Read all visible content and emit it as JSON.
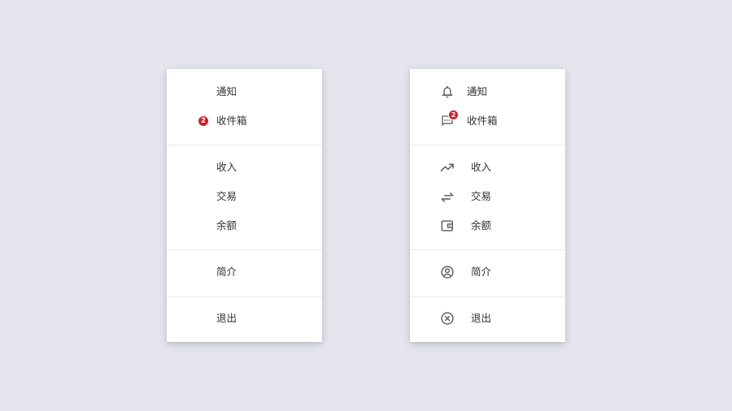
{
  "colors": {
    "background": "#e4e5ed",
    "menu": "#ffffff",
    "badge": "#d0202b",
    "icon": "#5f6368",
    "text": "#333333"
  },
  "menu_left": {
    "notifications_label": "通知",
    "inbox_label": "收件箱",
    "inbox_badge": "2",
    "income_label": "收入",
    "transactions_label": "交易",
    "balance_label": "余额",
    "profile_label": "简介",
    "logout_label": "退出"
  },
  "menu_right": {
    "notifications_label": "通知",
    "notifications_icon": "bell-icon",
    "inbox_label": "收件箱",
    "inbox_icon": "message-icon",
    "inbox_badge": "2",
    "income_label": "收入",
    "income_icon": "trending-up-icon",
    "transactions_label": "交易",
    "transactions_icon": "swap-arrows-icon",
    "balance_label": "余额",
    "balance_icon": "wallet-icon",
    "profile_label": "简介",
    "profile_icon": "account-circle-icon",
    "logout_label": "退出",
    "logout_icon": "close-circle-icon"
  }
}
